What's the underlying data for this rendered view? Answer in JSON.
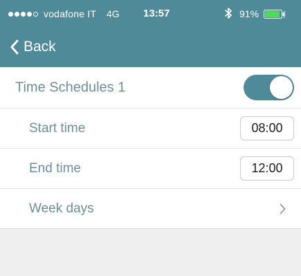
{
  "status_bar": {
    "signal_strength": "4 of 5",
    "carrier": "vodafone IT",
    "network": "4G",
    "time": "13:57",
    "bluetooth_icon": "bluetooth-icon",
    "battery_percent": "91%",
    "battery_level": 0.91,
    "battery_icon": "battery-charging-icon"
  },
  "nav": {
    "back_label": "Back",
    "back_icon": "chevron-left-icon"
  },
  "schedule": {
    "title": "Time Schedules 1",
    "enabled": true,
    "rows": [
      {
        "label": "Start time",
        "value": "08:00"
      },
      {
        "label": "End time",
        "value": "12:00"
      },
      {
        "label": "Week days"
      }
    ]
  },
  "colors": {
    "accent": "#4e8a97",
    "label": "#6d8e98",
    "battery_fill": "#4cd964",
    "background_gray": "#efefef"
  }
}
